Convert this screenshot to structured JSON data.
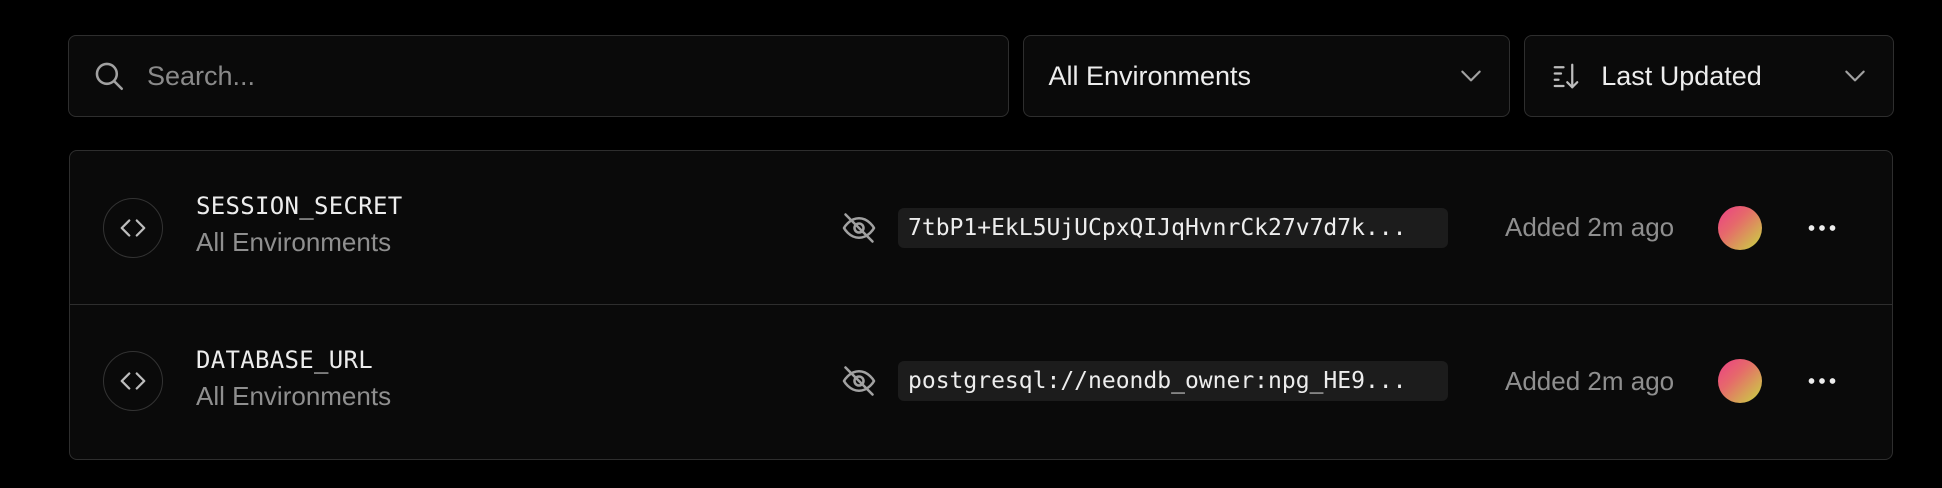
{
  "search": {
    "placeholder": "Search..."
  },
  "filters": {
    "environment": "All Environments",
    "sort": "Last Updated"
  },
  "variables": [
    {
      "name": "SESSION_SECRET",
      "environment": "All Environments",
      "value": "7tbP1+EkL5UjUCpxQIJqHvnrCk27v7d7k...",
      "added": "Added 2m ago"
    },
    {
      "name": "DATABASE_URL",
      "environment": "All Environments",
      "value": "postgresql://neondb_owner:npg_HE9...",
      "added": "Added 2m ago"
    }
  ],
  "colors": {
    "background": "#000000",
    "panel": "#0a0a0a",
    "border": "#2e2e2e",
    "muted_text": "#8f8f8f",
    "value_bg": "#1c1c1c"
  },
  "icons": {
    "search": "search-icon",
    "chevron": "chevron-down-icon",
    "sort": "sort-icon",
    "code": "code-icon",
    "eye_off": "eye-off-icon",
    "more": "more-horizontal-icon"
  }
}
